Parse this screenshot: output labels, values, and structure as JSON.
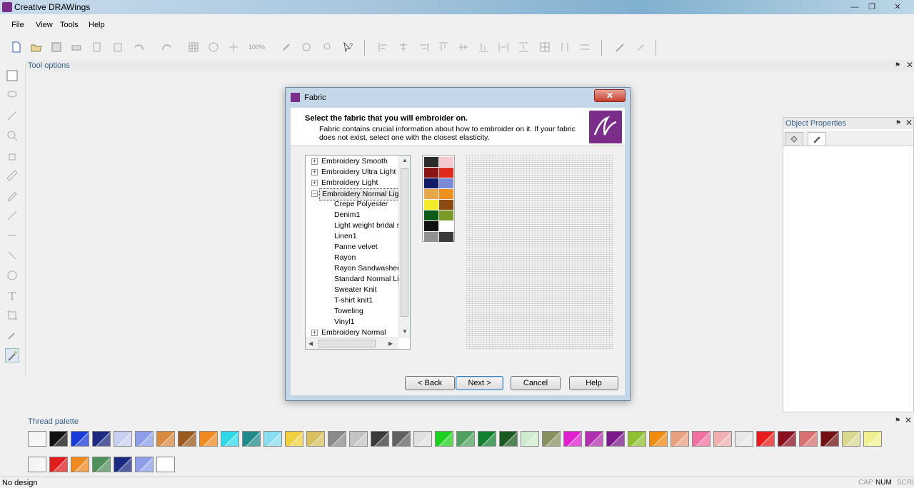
{
  "window": {
    "title": "Creative DRAWings"
  },
  "menu": {
    "items": [
      "File",
      "View",
      "Tools",
      "Help"
    ]
  },
  "toolbar": {
    "zoom": "100%"
  },
  "panels": {
    "tool_options": "Tool options",
    "object_properties": "Object Properties",
    "thread_palette": "Thread palette"
  },
  "status": {
    "text": "No design",
    "indicators": [
      "CAP",
      "NUM",
      "SCRL"
    ]
  },
  "dialog": {
    "title": "Fabric",
    "heading": "Select the fabric that you will embroider on.",
    "description": "Fabric contains crucial information about how to embroider on it. If your fabric does not exist, select one with the closest elasticity.",
    "tree": {
      "groups_before": [
        "Embroidery Smooth",
        "Embroidery Ultra Light",
        "Embroidery Light"
      ],
      "expanded_group": "Embroidery Normal Light",
      "children": [
        "Crepe Polyester",
        "Denim1",
        "Light weight bridal s",
        "Linen1",
        "Panne velvet",
        "Rayon",
        "Rayon Sandwashed",
        "Standard Normal Lig",
        "Sweater Knit",
        "T-shirt knit1",
        "Toweling",
        "Vinyl1"
      ],
      "groups_after": [
        "Embroidery Normal"
      ]
    },
    "buttons": {
      "back": "< Back",
      "next": "Next >",
      "cancel": "Cancel",
      "help": "Help"
    }
  },
  "fabric_colors": [
    "#2b2b2b",
    "#f6c9d0",
    "#8a1414",
    "#e02a1c",
    "#101a66",
    "#7a8ad6",
    "#e8a74a",
    "#f0901e",
    "#f2ea2a",
    "#8a4a10",
    "#0c5a1a",
    "#7a9a2a",
    "#101010",
    "#ffffff",
    "#909090",
    "#3a3a3a"
  ],
  "thread_row1": [
    "#f4f4f4",
    "#111111",
    "#1a3ad8",
    "#1c2a80",
    "#c8cff0",
    "#8e9ee8",
    "#d88a40",
    "#9a5a20",
    "#f08a20",
    "#30d8e8",
    "#208a8a",
    "#8adcf0",
    "#f0d040",
    "#d8c060",
    "#8a8a8a",
    "#c4c4c4",
    "#3a3a3a",
    "#606060",
    "#e0e0e0",
    "#20d020",
    "#50a060",
    "#108030",
    "#1a5a20",
    "#d0ecd0",
    "#8a9060",
    "#e020d0",
    "#b030b0",
    "#7a1a8a",
    "#90c030",
    "#f08a10",
    "#e8a080",
    "#f070a0",
    "#f0b0b0",
    "#e8e8e8",
    "#e81c1c",
    "#8a1020",
    "#d87070",
    "#701010",
    "#d8d890",
    "#f0f090"
  ],
  "thread_row2": [
    "#f4f4f4",
    "#e01c1c",
    "#f08a20",
    "#50905a",
    "#1a2a80",
    "#8e9ee8",
    "#ffffff"
  ]
}
